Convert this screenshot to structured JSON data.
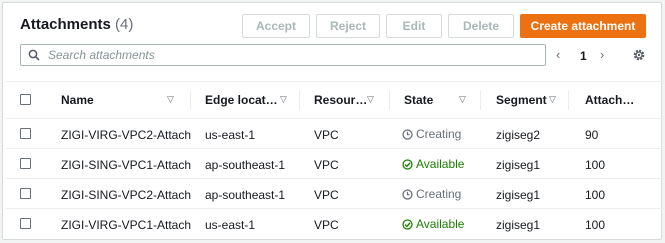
{
  "header": {
    "title": "Attachments",
    "count": "(4)"
  },
  "actions": {
    "accept": "Accept",
    "reject": "Reject",
    "edit": "Edit",
    "delete": "Delete",
    "create": "Create attachment"
  },
  "search": {
    "placeholder": "Search attachments"
  },
  "pagination": {
    "prev": "‹",
    "page": "1",
    "next": "›"
  },
  "icons": {
    "search": "search-icon",
    "settings": "gear-icon",
    "creating": "clock-icon",
    "available": "check-circle-icon",
    "sort": "caret-down-icon"
  },
  "colors": {
    "primary": "#ec7211",
    "available": "#1d8102",
    "pending": "#687078"
  },
  "table": {
    "columns": [
      "Name",
      "Edge locat…",
      "Resour…",
      "State",
      "Segment",
      "Attach…"
    ],
    "rows": [
      {
        "name": "ZIGI-VIRG-VPC2-Attach",
        "edge": "us-east-1",
        "resource": "VPC",
        "state": "Creating",
        "segment": "zigiseg2",
        "attach": "90"
      },
      {
        "name": "ZIGI-SING-VPC1-Attach",
        "edge": "ap-southeast-1",
        "resource": "VPC",
        "state": "Available",
        "segment": "zigiseg1",
        "attach": "100"
      },
      {
        "name": "ZIGI-SING-VPC2-Attach",
        "edge": "ap-southeast-1",
        "resource": "VPC",
        "state": "Creating",
        "segment": "zigiseg1",
        "attach": "100"
      },
      {
        "name": "ZIGI-VIRG-VPC1-Attach",
        "edge": "us-east-1",
        "resource": "VPC",
        "state": "Available",
        "segment": "zigiseg1",
        "attach": "100"
      }
    ]
  }
}
